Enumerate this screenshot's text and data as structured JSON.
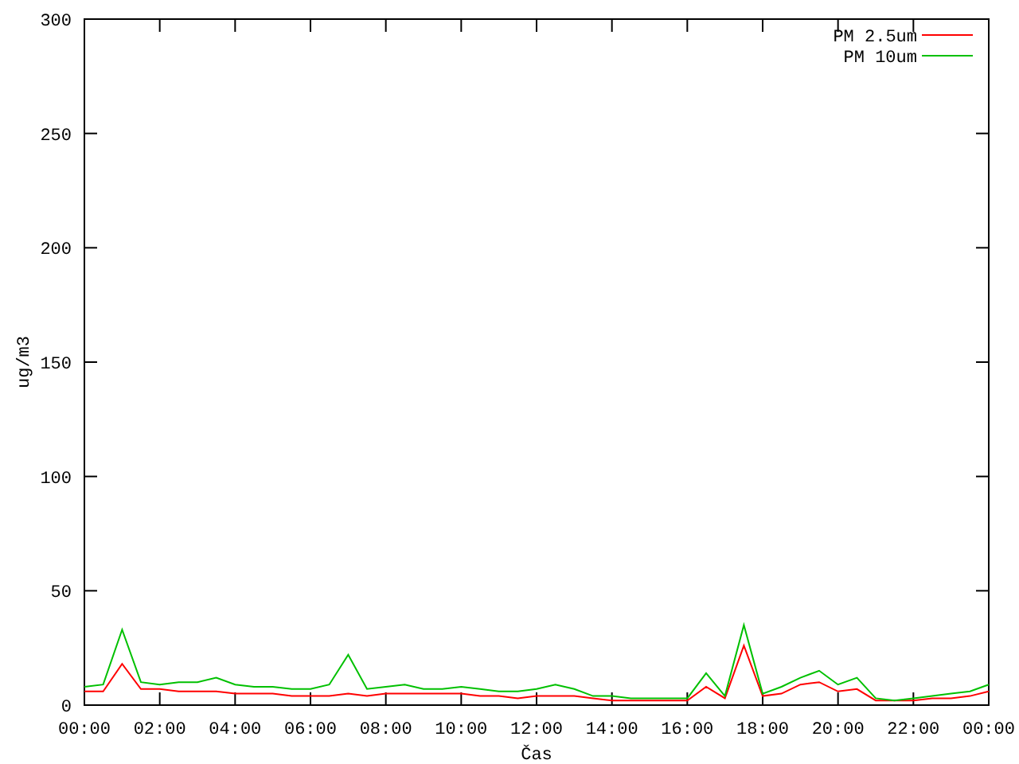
{
  "chart_data": {
    "type": "line",
    "xlabel": "Čas",
    "ylabel": "ug/m3",
    "x": [
      0,
      0.5,
      1,
      1.5,
      2,
      2.5,
      3,
      3.5,
      4,
      4.5,
      5,
      5.5,
      6,
      6.5,
      7,
      7.5,
      8,
      8.5,
      9,
      9.5,
      10,
      10.5,
      11,
      11.5,
      12,
      12.5,
      13,
      13.5,
      14,
      14.5,
      15,
      15.5,
      16,
      16.5,
      17,
      17.5,
      18,
      18.5,
      19,
      19.5,
      20,
      20.5,
      21,
      21.5,
      22,
      22.5,
      23,
      23.5,
      24
    ],
    "series": [
      {
        "name": "PM 2.5um",
        "color": "#ff0000",
        "values": [
          6,
          6,
          18,
          7,
          7,
          6,
          6,
          6,
          5,
          5,
          5,
          4,
          4,
          4,
          5,
          4,
          5,
          5,
          5,
          5,
          5,
          4,
          4,
          3,
          4,
          4,
          4,
          3,
          2,
          2,
          2,
          2,
          2,
          8,
          3,
          26,
          4,
          5,
          9,
          10,
          6,
          7,
          2,
          2,
          2,
          3,
          3,
          4,
          6
        ]
      },
      {
        "name": "PM 10um",
        "color": "#00c000",
        "values": [
          8,
          9,
          33,
          10,
          9,
          10,
          10,
          12,
          9,
          8,
          8,
          7,
          7,
          9,
          22,
          7,
          8,
          9,
          7,
          7,
          8,
          7,
          6,
          6,
          7,
          9,
          7,
          4,
          4,
          3,
          3,
          3,
          3,
          14,
          4,
          35,
          5,
          8,
          12,
          15,
          9,
          12,
          3,
          2,
          3,
          4,
          5,
          6,
          9
        ]
      }
    ],
    "legend": true,
    "xlim": [
      0,
      24
    ],
    "ylim": [
      0,
      300
    ],
    "xticks": [
      {
        "value": 0,
        "label": "00:00"
      },
      {
        "value": 2,
        "label": "02:00"
      },
      {
        "value": 4,
        "label": "04:00"
      },
      {
        "value": 6,
        "label": "06:00"
      },
      {
        "value": 8,
        "label": "08:00"
      },
      {
        "value": 10,
        "label": "10:00"
      },
      {
        "value": 12,
        "label": "12:00"
      },
      {
        "value": 14,
        "label": "14:00"
      },
      {
        "value": 16,
        "label": "16:00"
      },
      {
        "value": 18,
        "label": "18:00"
      },
      {
        "value": 20,
        "label": "20:00"
      },
      {
        "value": 22,
        "label": "22:00"
      },
      {
        "value": 24,
        "label": "00:00"
      }
    ],
    "yticks": [
      0,
      50,
      100,
      150,
      200,
      250,
      300
    ]
  }
}
